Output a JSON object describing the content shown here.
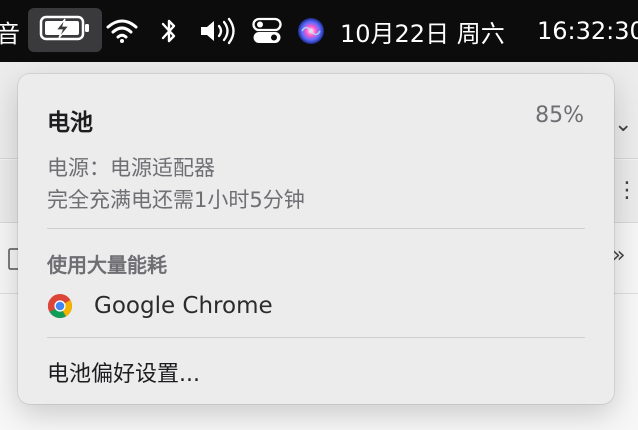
{
  "menubar": {
    "left_partial": "音",
    "date": "10月22日 周六",
    "time": "16:32:30",
    "icons": [
      "battery-charging-icon",
      "wifi-icon",
      "bluetooth-icon",
      "volume-icon",
      "control-center-icon",
      "siri-icon"
    ]
  },
  "battery_popover": {
    "title": "电池",
    "percent": "85%",
    "power_source": "电源：电源适配器",
    "time_remaining": "完全充满电还需1小时5分钟",
    "heavy_usage_header": "使用大量能耗",
    "apps": [
      {
        "name": "Google Chrome",
        "icon": "chrome-icon"
      }
    ],
    "preferences": "电池偏好设置..."
  },
  "colors": {
    "menubar_bg": "#0c0c0d",
    "popover_bg": "#ececec",
    "secondary_text": "#6e6e73"
  }
}
